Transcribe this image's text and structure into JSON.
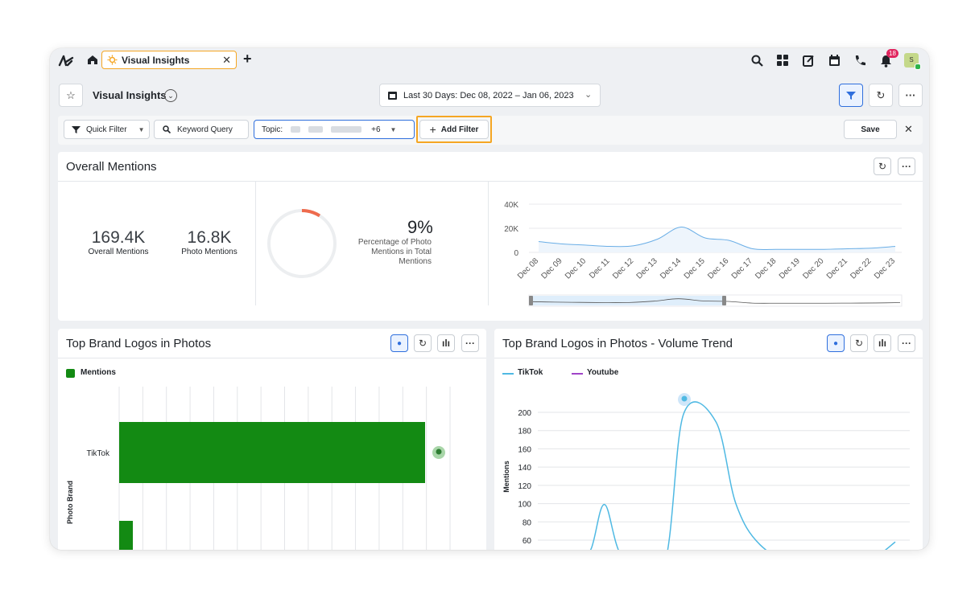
{
  "topbar": {
    "tab_label": "Visual Insights",
    "notification_count": "18",
    "avatar_initial": "S"
  },
  "header": {
    "title": "Visual Insights",
    "date_range": "Last 30 Days: Dec 08, 2022 – Jan 06, 2023"
  },
  "filters": {
    "quick_filter": "Quick Filter",
    "keyword_query_placeholder": "Keyword Query",
    "topic_label": "Topic:",
    "topic_more": "+6",
    "add_filter": "Add Filter",
    "save": "Save"
  },
  "overall": {
    "title": "Overall Mentions",
    "overall_value": "169.4K",
    "overall_label": "Overall Mentions",
    "photo_value": "16.8K",
    "photo_label": "Photo Mentions",
    "percent_value": "9%",
    "percent_label_lines": [
      "Percentage of Photo",
      "Mentions in Total",
      "Mentions"
    ],
    "percent_fraction": 0.09
  },
  "brand_logos": {
    "title": "Top Brand Logos in Photos",
    "legend": "Mentions",
    "y_axis_label": "Photo Brand",
    "brand_label": "TikTok"
  },
  "volume_trend": {
    "title": "Top Brand Logos in Photos - Volume Trend",
    "legend": [
      "TikTok",
      "Youtube"
    ],
    "y_axis_label": "Mentions"
  },
  "colors": {
    "accent": "#2f6fdd",
    "highlight_orange": "#f5a623",
    "bar_green": "#138a13",
    "tiktok_line": "#4fb9e3",
    "youtube_line": "#a044c8",
    "trend_line": "#6aaee6"
  },
  "chart_data": [
    {
      "type": "area",
      "x": [
        "Dec 08",
        "Dec 09",
        "Dec 10",
        "Dec 11",
        "Dec 12",
        "Dec 13",
        "Dec 14",
        "Dec 15",
        "Dec 16",
        "Dec 17",
        "Dec 18",
        "Dec 19",
        "Dec 20",
        "Dec 21",
        "Dec 22",
        "Dec 23"
      ],
      "values": [
        9000,
        7000,
        6000,
        5000,
        5500,
        11000,
        21000,
        12000,
        10000,
        3000,
        2500,
        2500,
        2500,
        3000,
        3500,
        5000
      ],
      "yticks": [
        "0",
        "20K",
        "40K"
      ],
      "ylim": [
        0,
        40000
      ]
    },
    {
      "type": "bar",
      "categories": [
        "TikTok"
      ],
      "values": [
        1
      ]
    },
    {
      "type": "line",
      "series": [
        {
          "name": "TikTok",
          "x": [
            0,
            1,
            2,
            3,
            4,
            5,
            6,
            7,
            8,
            9,
            10,
            11,
            12
          ],
          "values": [
            30,
            50,
            99,
            40,
            30,
            198,
            190,
            100,
            55,
            30,
            30,
            40,
            58
          ]
        }
      ],
      "yticks": [
        "60",
        "80",
        "100",
        "120",
        "140",
        "160",
        "180",
        "200"
      ],
      "ylabel": "Mentions",
      "ylim": [
        60,
        200
      ]
    }
  ]
}
